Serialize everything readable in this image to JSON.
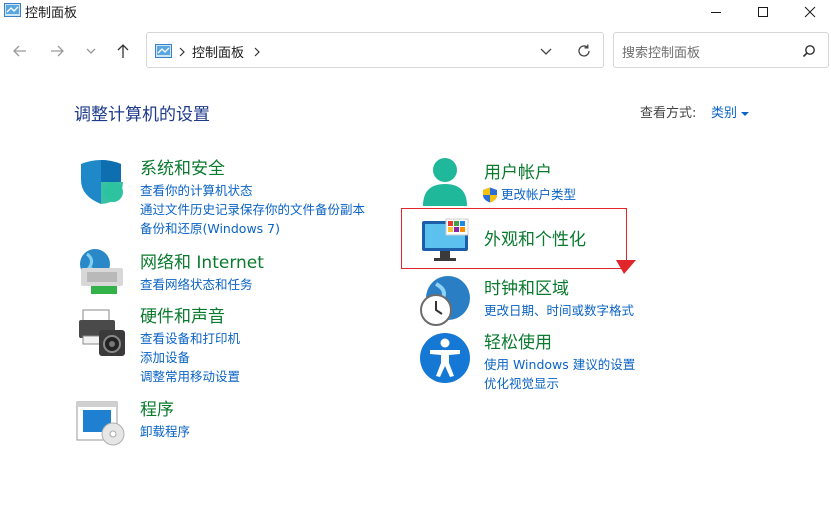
{
  "window": {
    "title": "控制面板"
  },
  "address": {
    "crumb": "控制面板"
  },
  "search": {
    "placeholder": "搜索控制面板"
  },
  "main": {
    "title": "调整计算机的设置",
    "view_by_label": "查看方式:",
    "view_by_value": "类别"
  },
  "categories": {
    "system": {
      "title": "系统和安全",
      "links": [
        "查看你的计算机状态",
        "通过文件历史记录保存你的文件备份副本",
        "备份和还原(Windows 7)"
      ]
    },
    "network": {
      "title": "网络和 Internet",
      "links": [
        "查看网络状态和任务"
      ]
    },
    "hardware": {
      "title": "硬件和声音",
      "links": [
        "查看设备和打印机",
        "添加设备",
        "调整常用移动设置"
      ]
    },
    "programs": {
      "title": "程序",
      "links": [
        "卸载程序"
      ]
    },
    "users": {
      "title": "用户帐户",
      "links": [
        "更改帐户类型"
      ]
    },
    "appearance": {
      "title": "外观和个性化"
    },
    "clock": {
      "title": "时钟和区域",
      "links": [
        "更改日期、时间或数字格式"
      ]
    },
    "ease": {
      "title": "轻松使用",
      "links": [
        "使用 Windows 建议的设置",
        "优化视觉显示"
      ]
    }
  },
  "colors": {
    "category_title": "#0a7a2e",
    "link": "#0b63c5",
    "highlight": "#e0262a"
  }
}
